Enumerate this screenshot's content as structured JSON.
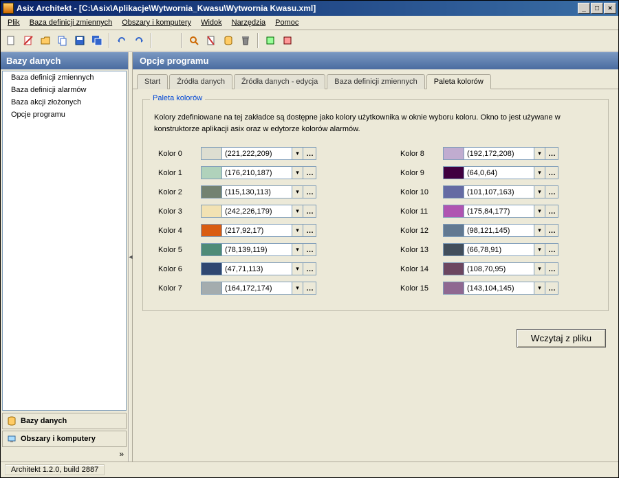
{
  "title": "Asix Architekt - [C:\\Asix\\Aplikacje\\Wytwornia_Kwasu\\Wytwornia Kwasu.xml]",
  "win_buttons": {
    "min": "_",
    "max": "□",
    "close": "×"
  },
  "menu": [
    "Plik",
    "Baza definicji zmiennych",
    "Obszary i komputery",
    "Widok",
    "Narzędzia",
    "Pomoc"
  ],
  "sidebar": {
    "header": "Bazy danych",
    "items": [
      "Baza definicji zmiennych",
      "Baza definicji alarmów",
      "Baza akcji złożonych",
      "Opcje programu"
    ],
    "bottom1": "Bazy danych",
    "bottom2": "Obszary i komputery"
  },
  "main": {
    "header": "Opcje programu",
    "tabs": [
      "Start",
      "Źródła danych",
      "Źródła danych - edycja",
      "Baza definicji zmiennych",
      "Paleta kolorów"
    ],
    "active_tab": 4
  },
  "group": {
    "legend": "Paleta kolorów",
    "desc": "Kolory zdefiniowane na tej zakładce są dostępne jako kolory użytkownika w oknie wyboru koloru. Okno to jest używane w konstruktorze aplikacji asix oraz w  edytorze kolorów alarmów."
  },
  "colors_left": [
    {
      "label": "Kolor 0",
      "rgb": "(221,222,209)",
      "hex": "#ddded1"
    },
    {
      "label": "Kolor 1",
      "rgb": "(176,210,187)",
      "hex": "#b0d2bb"
    },
    {
      "label": "Kolor 2",
      "rgb": "(115,130,113)",
      "hex": "#738271"
    },
    {
      "label": "Kolor 3",
      "rgb": "(242,226,179)",
      "hex": "#f2e2b3"
    },
    {
      "label": "Kolor 4",
      "rgb": "(217,92,17)",
      "hex": "#d95c11"
    },
    {
      "label": "Kolor 5",
      "rgb": "(78,139,119)",
      "hex": "#4e8b77"
    },
    {
      "label": "Kolor 6",
      "rgb": "(47,71,113)",
      "hex": "#2f4771"
    },
    {
      "label": "Kolor 7",
      "rgb": "(164,172,174)",
      "hex": "#a4acae"
    }
  ],
  "colors_right": [
    {
      "label": "Kolor 8",
      "rgb": "(192,172,208)",
      "hex": "#c0acd0"
    },
    {
      "label": "Kolor 9",
      "rgb": "(64,0,64)",
      "hex": "#400040"
    },
    {
      "label": "Kolor 10",
      "rgb": "(101,107,163)",
      "hex": "#656ba3"
    },
    {
      "label": "Kolor 11",
      "rgb": "(175,84,177)",
      "hex": "#af54b1"
    },
    {
      "label": "Kolor 12",
      "rgb": "(98,121,145)",
      "hex": "#627991"
    },
    {
      "label": "Kolor 13",
      "rgb": "(66,78,91)",
      "hex": "#424e5b"
    },
    {
      "label": "Kolor 14",
      "rgb": "(108,70,95)",
      "hex": "#6c465f"
    },
    {
      "label": "Kolor 15",
      "rgb": "(143,104,145)",
      "hex": "#8f6891"
    }
  ],
  "load_button": "Wczytaj z pliku",
  "status": "Architekt 1.2.0, build 2887"
}
